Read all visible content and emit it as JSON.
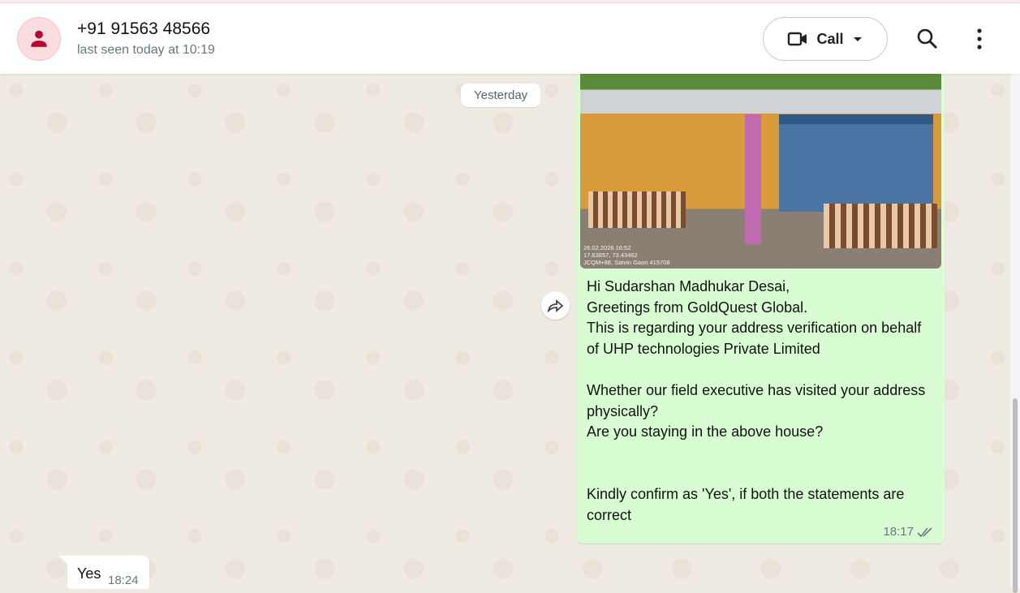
{
  "header": {
    "name": "+91 91563 48566",
    "status": "last seen today at 10:19",
    "call_label": "Call"
  },
  "chat": {
    "date_divider": "Yesterday",
    "outgoing": {
      "photo_stamp": [
        "26.02.2026 16:52",
        "17.63857, 73.43462",
        "JCQM+88, Satvin Gaon 415708"
      ],
      "text": "Hi Sudarshan Madhukar Desai,\nGreetings from GoldQuest Global.\nThis is regarding your address verification on behalf of UHP technologies Private Limited\n\nWhether our field executive has visited your address physically?\nAre you staying in the above house?\n\n\nKindly confirm as 'Yes', if both the statements are correct",
      "time": "18:17"
    },
    "incoming": {
      "text": "Yes",
      "time": "18:24"
    }
  }
}
